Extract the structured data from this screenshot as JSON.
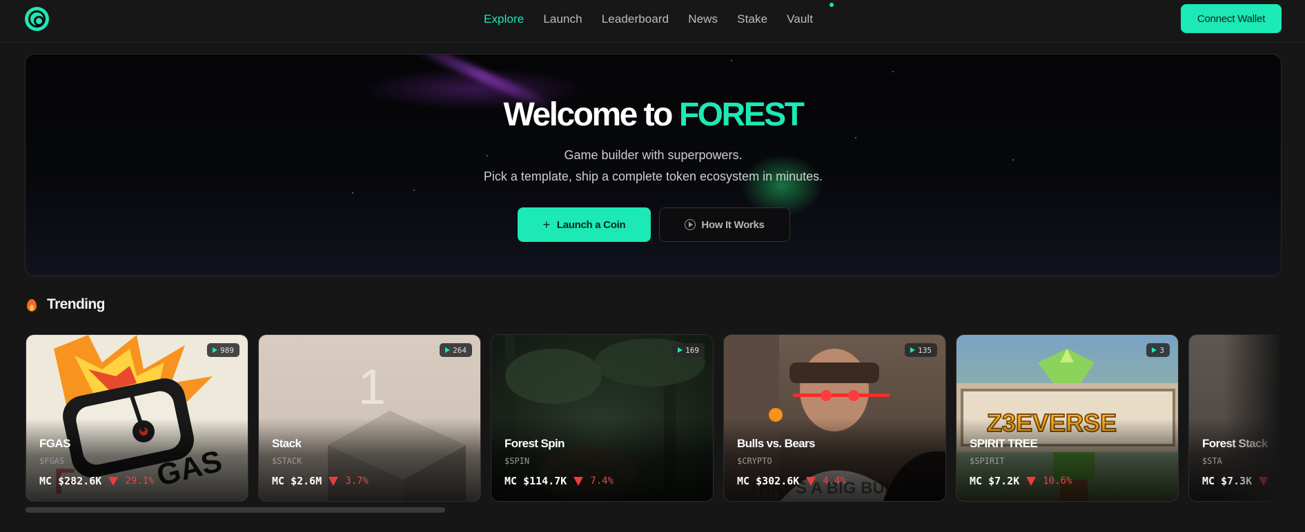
{
  "header": {
    "logo": "forest-logo",
    "nav": [
      {
        "label": "Explore",
        "active": true
      },
      {
        "label": "Launch",
        "active": false
      },
      {
        "label": "Leaderboard",
        "active": false
      },
      {
        "label": "News",
        "active": false
      },
      {
        "label": "Stake",
        "active": false
      },
      {
        "label": "Vault",
        "active": false
      }
    ],
    "connect_label": "Connect Wallet"
  },
  "hero": {
    "title_prefix": "Welcome to ",
    "title_accent": "FOREST",
    "subtitle_line1": "Game builder with superpowers.",
    "subtitle_line2": "Pick a template, ship a complete token ecosystem in minutes.",
    "launch_label": "Launch a Coin",
    "how_label": "How It Works"
  },
  "trending": {
    "title": "Trending",
    "cards": [
      {
        "name": "FGAS",
        "ticker": "$FGAS",
        "mc": "MC $282.6K",
        "change": "29.1%",
        "plays": "989"
      },
      {
        "name": "Stack",
        "ticker": "$STACK",
        "mc": "MC $2.6M",
        "change": "3.7%",
        "plays": "264"
      },
      {
        "name": "Forest Spin",
        "ticker": "$SPIN",
        "mc": "MC $114.7K",
        "change": "7.4%",
        "plays": "169"
      },
      {
        "name": "Bulls vs. Bears",
        "ticker": "$CRYPTO",
        "mc": "MC $302.6K",
        "change": "4.4%",
        "plays": "135"
      },
      {
        "name": "SPIRIT TREE",
        "ticker": "$SPIRIT",
        "mc": "MC $7.2K",
        "change": "10.6%",
        "plays": "3"
      },
      {
        "name": "Forest Stack",
        "ticker": "$STA",
        "mc": "MC $7.3K",
        "change": "",
        "plays": ""
      }
    ]
  },
  "colors": {
    "accent": "#1de9b6",
    "down": "#ef4444",
    "background": "#161616"
  }
}
